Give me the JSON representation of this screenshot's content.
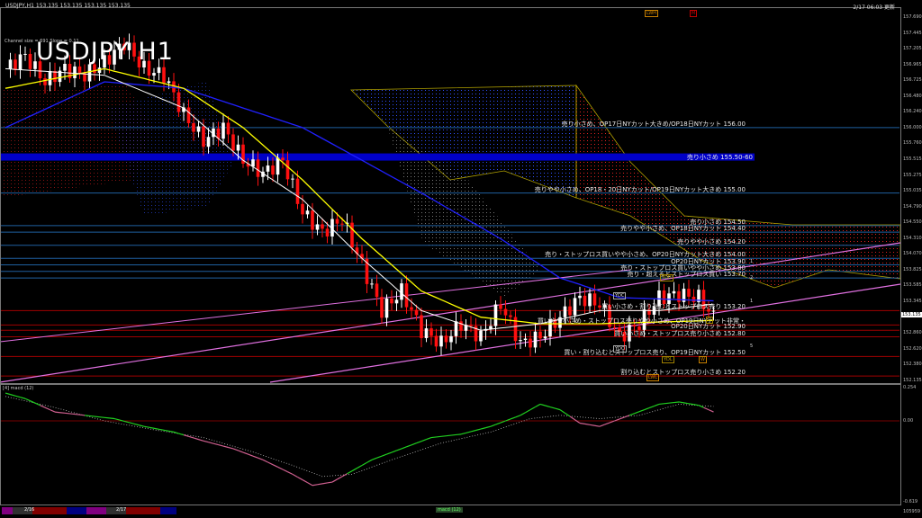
{
  "header": {
    "symbol_line": "USDJPY,H1  153.135 153.135 153.135 153.135",
    "symbol_big": "USDJPY H1",
    "channel_info": "Channel size = 691 Slope = 0.11",
    "clock": "2/17 06:03 更新"
  },
  "price_axis": {
    "labels": [
      "157.690",
      "157.445",
      "157.205",
      "156.965",
      "156.725",
      "156.480",
      "156.240",
      "156.000",
      "155.760",
      "155.515",
      "155.275",
      "155.035",
      "154.790",
      "154.550",
      "154.310",
      "154.070",
      "153.825",
      "153.585",
      "153.345",
      "152.860",
      "152.620",
      "152.380",
      "152.135"
    ],
    "current_price": "153.135"
  },
  "levels": [
    {
      "price": 156.0,
      "kind": "sell",
      "text": "売り小さめ、OP17日NYカット大きめ/OP18日NYカット 156.00"
    },
    {
      "price": 155.55,
      "kind": "band",
      "text": "売り小さめ 155.50-60"
    },
    {
      "price": 155.0,
      "kind": "sell",
      "text": "売りやや小さめ、OP18・20日NYカット/OP19日NYカット大きめ 155.00"
    },
    {
      "price": 154.5,
      "kind": "sell",
      "text": "売り小さめ 154.50"
    },
    {
      "price": 154.4,
      "kind": "sell",
      "text": "売りやや小さめ、OP18日NYカット 154.40"
    },
    {
      "price": 154.2,
      "kind": "sell",
      "text": "売りやや小さめ 154.20"
    },
    {
      "price": 154.0,
      "kind": "sell",
      "text": "売り・ストップロス買いやや小さめ、OP20日NYカット大きめ 154.00"
    },
    {
      "price": 153.9,
      "kind": "sell",
      "text": "OP20日NYカット 153.90"
    },
    {
      "price": 153.8,
      "kind": "sell",
      "text": "売り・ストップロス買いやや小さめ 153.80"
    },
    {
      "price": 153.7,
      "kind": "sell",
      "text": "売り・超えるとストップロス買い 153.70"
    },
    {
      "price": 153.2,
      "kind": "buy",
      "text": "買い小さめ・割り込むとストップロス売り 153.20"
    },
    {
      "price": 152.98,
      "kind": "buy",
      "text": "買いやや小さめ・ストップロス売りやや小さめ、OP19日NYカット非常・"
    },
    {
      "price": 152.9,
      "kind": "buy",
      "text": "OP20日NYカット 152.90"
    },
    {
      "price": 152.8,
      "kind": "buy",
      "text": "買い小さめ・ストップロス売り小さめ 152.80"
    },
    {
      "price": 152.5,
      "kind": "buy",
      "text": "買い・割り込むとストップロス売り、OP19日NYカット 152.50"
    },
    {
      "price": 152.2,
      "kind": "buy",
      "text": "割り込むとストップロス売り小さめ 152.20"
    }
  ],
  "tags": {
    "lwh": "LWH",
    "m": "M",
    "ydh": "YDH",
    "ydc": "YDC",
    "ydo": "YDO",
    "ydl": "YDL",
    "lwl": "LWL",
    "w": "W",
    "d": "D",
    "fib": [
      "1",
      "2",
      "3",
      "5"
    ]
  },
  "sub_window": {
    "title": "[4]  macd (12)",
    "max_label": "0.254",
    "zero_label": "0.00",
    "min_label": "-0.619",
    "bottom_label": "105959"
  },
  "bottom_bar": {
    "dates": [
      "2/16",
      "2/17"
    ],
    "tab": "macd (12)"
  },
  "colors": {
    "sell": "#1f5f9f",
    "buy": "#a00000",
    "band": "#0000c8",
    "up": "#ffffff",
    "down": "#ff1010",
    "ma_fast": "#ffffff",
    "ma_mid": "#ffff00",
    "ma_slow": "#2020ff",
    "channel": "#e070e0"
  },
  "chart_data": {
    "type": "line",
    "title": "USDJPY H1",
    "ylim": [
      152.135,
      157.69
    ],
    "close_keypoints": [
      [
        0,
        156.9
      ],
      [
        4,
        157.1
      ],
      [
        8,
        156.7
      ],
      [
        12,
        156.9
      ],
      [
        16,
        156.8
      ],
      [
        20,
        157.0
      ],
      [
        24,
        157.3
      ],
      [
        28,
        156.9
      ],
      [
        32,
        156.8
      ],
      [
        36,
        156.2
      ],
      [
        40,
        155.8
      ],
      [
        44,
        156.0
      ],
      [
        48,
        155.5
      ],
      [
        52,
        155.3
      ],
      [
        56,
        155.5
      ],
      [
        60,
        154.7
      ],
      [
        64,
        154.4
      ],
      [
        68,
        154.6
      ],
      [
        72,
        153.9
      ],
      [
        76,
        153.2
      ],
      [
        80,
        153.5
      ],
      [
        84,
        152.9
      ],
      [
        88,
        152.7
      ],
      [
        92,
        153.0
      ],
      [
        96,
        152.8
      ],
      [
        100,
        153.3
      ],
      [
        104,
        152.7
      ],
      [
        108,
        152.8
      ],
      [
        112,
        153.1
      ],
      [
        116,
        153.4
      ],
      [
        120,
        153.3
      ],
      [
        124,
        152.8
      ],
      [
        128,
        153.0
      ],
      [
        132,
        153.4
      ],
      [
        136,
        153.45
      ],
      [
        140,
        153.4
      ],
      [
        143,
        153.1
      ]
    ],
    "ma_fast": [
      [
        0,
        156.9
      ],
      [
        20,
        156.8
      ],
      [
        36,
        156.3
      ],
      [
        48,
        155.5
      ],
      [
        60,
        154.9
      ],
      [
        72,
        154.0
      ],
      [
        84,
        153.2
      ],
      [
        96,
        152.9
      ],
      [
        108,
        153.0
      ],
      [
        120,
        153.2
      ],
      [
        132,
        153.2
      ],
      [
        143,
        153.3
      ]
    ],
    "ma_mid": [
      [
        0,
        156.6
      ],
      [
        20,
        156.9
      ],
      [
        36,
        156.6
      ],
      [
        48,
        156.0
      ],
      [
        60,
        155.2
      ],
      [
        72,
        154.3
      ],
      [
        84,
        153.5
      ],
      [
        96,
        153.1
      ],
      [
        108,
        153.0
      ],
      [
        120,
        153.0
      ],
      [
        143,
        153.05
      ]
    ],
    "ma_slow": [
      [
        0,
        156.0
      ],
      [
        20,
        156.7
      ],
      [
        36,
        156.6
      ],
      [
        60,
        156.0
      ],
      [
        84,
        155.0
      ],
      [
        100,
        154.3
      ],
      [
        112,
        153.7
      ],
      [
        124,
        153.4
      ],
      [
        143,
        153.35
      ]
    ],
    "macd": [
      [
        0,
        0.25
      ],
      [
        4,
        0.2
      ],
      [
        10,
        0.08
      ],
      [
        16,
        0.05
      ],
      [
        22,
        0.02
      ],
      [
        28,
        -0.05
      ],
      [
        34,
        -0.1
      ],
      [
        40,
        -0.18
      ],
      [
        46,
        -0.25
      ],
      [
        52,
        -0.35
      ],
      [
        58,
        -0.48
      ],
      [
        62,
        -0.58
      ],
      [
        66,
        -0.55
      ],
      [
        70,
        -0.45
      ],
      [
        74,
        -0.35
      ],
      [
        80,
        -0.25
      ],
      [
        86,
        -0.15
      ],
      [
        92,
        -0.12
      ],
      [
        98,
        -0.05
      ],
      [
        104,
        0.05
      ],
      [
        108,
        0.15
      ],
      [
        112,
        0.1
      ],
      [
        116,
        -0.02
      ],
      [
        120,
        -0.05
      ],
      [
        126,
        0.05
      ],
      [
        132,
        0.15
      ],
      [
        136,
        0.17
      ],
      [
        140,
        0.14
      ],
      [
        143,
        0.08
      ]
    ],
    "signal": [
      [
        0,
        0.22
      ],
      [
        10,
        0.12
      ],
      [
        20,
        0.0
      ],
      [
        30,
        -0.08
      ],
      [
        40,
        -0.15
      ],
      [
        50,
        -0.28
      ],
      [
        58,
        -0.4
      ],
      [
        64,
        -0.5
      ],
      [
        70,
        -0.48
      ],
      [
        78,
        -0.35
      ],
      [
        88,
        -0.2
      ],
      [
        98,
        -0.1
      ],
      [
        106,
        0.02
      ],
      [
        112,
        0.05
      ],
      [
        120,
        0.02
      ],
      [
        128,
        0.05
      ],
      [
        136,
        0.15
      ],
      [
        143,
        0.13
      ]
    ]
  }
}
